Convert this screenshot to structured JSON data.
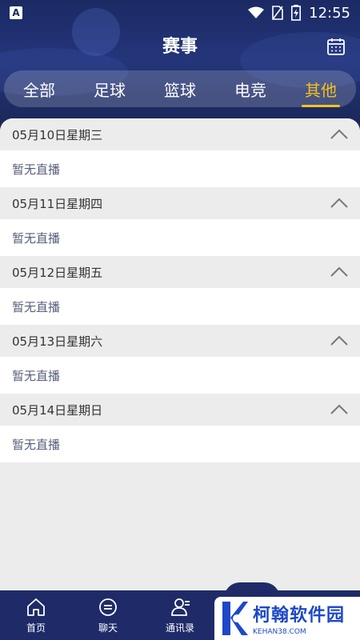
{
  "status_bar": {
    "time": "12:55",
    "app_badge": "A"
  },
  "header": {
    "title": "赛事"
  },
  "tabs": [
    {
      "label": "全部",
      "active": false
    },
    {
      "label": "足球",
      "active": false
    },
    {
      "label": "篮球",
      "active": false
    },
    {
      "label": "电竞",
      "active": false
    },
    {
      "label": "其他",
      "active": true
    }
  ],
  "sections": [
    {
      "date": "05月10日星期三",
      "empty_text": "暂无直播"
    },
    {
      "date": "05月11日星期四",
      "empty_text": "暂无直播"
    },
    {
      "date": "05月12日星期五",
      "empty_text": "暂无直播"
    },
    {
      "date": "05月13日星期六",
      "empty_text": "暂无直播"
    },
    {
      "date": "05月14日星期日",
      "empty_text": "暂无直播"
    }
  ],
  "bottom_nav": [
    {
      "label": "首页",
      "icon": "home-icon"
    },
    {
      "label": "聊天",
      "icon": "chat-icon"
    },
    {
      "label": "通讯录",
      "icon": "contacts-icon"
    }
  ],
  "watermark": {
    "cn": "柯翰软件园",
    "en": "KEHAN38.COM"
  },
  "colors": {
    "accent": "#f4c21b",
    "header": "#1b2a63",
    "nav": "#1e2b68"
  }
}
